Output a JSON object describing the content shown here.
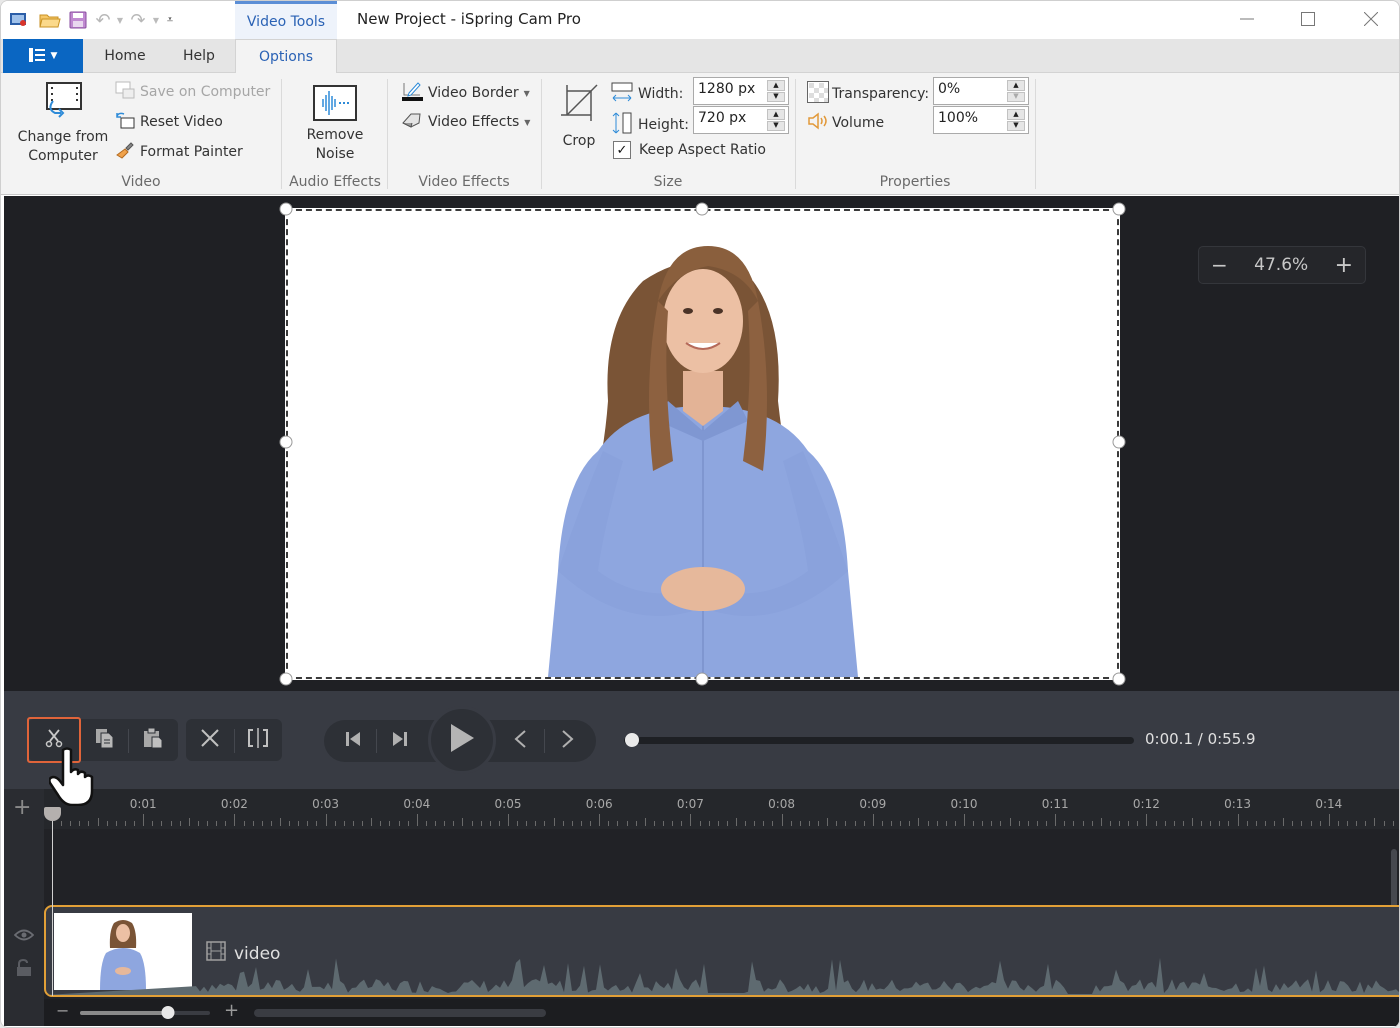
{
  "window": {
    "title": "New Project - iSpring Cam Pro",
    "context_tab": "Video Tools",
    "controls": {
      "minimize": "minimize-icon",
      "maximize": "maximize-icon",
      "close": "close-icon"
    }
  },
  "quick_access": [
    "app-icon",
    "open-folder-icon",
    "save-icon",
    "undo-icon",
    "redo-icon",
    "customize-icon"
  ],
  "tabs": [
    {
      "label": "Home",
      "active": false
    },
    {
      "label": "Help",
      "active": false
    },
    {
      "label": "Options",
      "active": true
    }
  ],
  "ribbon": {
    "video_group": {
      "label": "Video",
      "change_from_computer": "Change from Computer",
      "change_line1": "Change from",
      "change_line2": "Computer",
      "save_on_computer": "Save on Computer",
      "reset_video": "Reset Video",
      "format_painter": "Format Painter"
    },
    "audio_effects_group": {
      "label": "Audio Effects",
      "remove_noise_line1": "Remove",
      "remove_noise_line2": "Noise"
    },
    "video_effects_group": {
      "label": "Video Effects",
      "video_border": "Video Border",
      "video_effects": "Video Effects"
    },
    "size_group": {
      "label": "Size",
      "crop": "Crop",
      "width_label": "Width:",
      "width_value": "1280 px",
      "height_label": "Height:",
      "height_value": "720 px",
      "keep_aspect_ratio": "Keep Aspect Ratio",
      "keep_aspect_checked": true
    },
    "properties_group": {
      "label": "Properties",
      "transparency_label": "Transparency:",
      "transparency_value": "0%",
      "volume_label": "Volume",
      "volume_value": "100%"
    }
  },
  "canvas": {
    "zoom_level": "47.6%",
    "zoom_minus": "−",
    "zoom_plus": "+"
  },
  "controls": {
    "edit_buttons": [
      "cut",
      "copy",
      "paste",
      "delete",
      "split"
    ],
    "selected_button": "cut",
    "playback_buttons": [
      "go-to-start",
      "go-to-end",
      "play",
      "previous-frame",
      "next-frame"
    ],
    "timecode": "0:00.1 / 0:55.9",
    "seek_fraction": 0.002
  },
  "timeline": {
    "add_track": "+",
    "ruler_labels": [
      "0:01",
      "0:02",
      "0:03",
      "0:04",
      "0:05",
      "0:06",
      "0:07",
      "0:08",
      "0:09",
      "0:10",
      "0:11",
      "0:12",
      "0:13",
      "0:14"
    ],
    "track": {
      "label": "video",
      "visible": true,
      "locked": false
    },
    "zoom_minus": "−",
    "zoom_plus": "+",
    "zoom_fraction": 0.68
  }
}
